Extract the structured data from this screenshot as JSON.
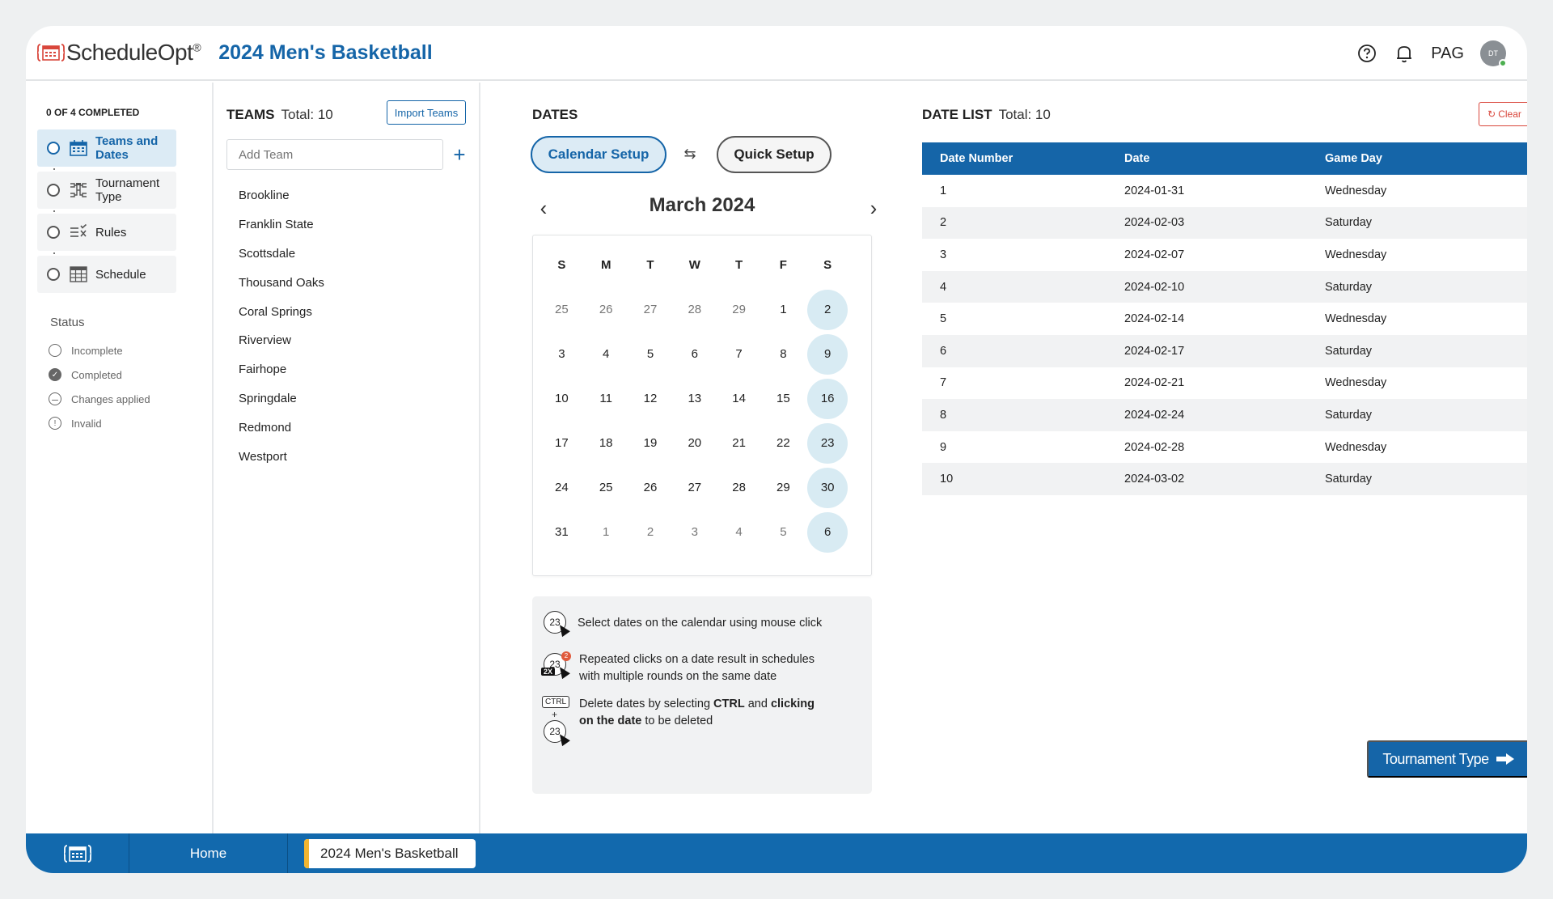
{
  "header": {
    "logo_text": "ScheduleOpt",
    "logo_reg": "®",
    "title": "2024 Men's Basketball",
    "user_initials_label": "PAG",
    "avatar_initials": "DT"
  },
  "progress": {
    "label": "0 OF 4 COMPLETED"
  },
  "steps": [
    {
      "label": "Teams and Dates",
      "icon": "calendar-icon",
      "active": true
    },
    {
      "label": "Tournament Type",
      "icon": "bracket-icon",
      "active": false
    },
    {
      "label": "Rules",
      "icon": "rules-icon",
      "active": false
    },
    {
      "label": "Schedule",
      "icon": "table-icon",
      "active": false
    }
  ],
  "status": {
    "title": "Status",
    "items": [
      {
        "label": "Incomplete",
        "icon": "empty-circle-icon"
      },
      {
        "label": "Completed",
        "icon": "check-circle-icon"
      },
      {
        "label": "Changes applied",
        "icon": "minus-circle-icon"
      },
      {
        "label": "Invalid",
        "icon": "exclamation-circle-icon"
      }
    ]
  },
  "teams": {
    "title": "TEAMS",
    "total": "Total: 10",
    "import_label": "Import Teams",
    "add_placeholder": "Add Team",
    "list": [
      "Brookline",
      "Franklin State",
      "Scottsdale",
      "Thousand Oaks",
      "Coral Springs",
      "Riverview",
      "Fairhope",
      "Springdale",
      "Redmond",
      "Westport"
    ]
  },
  "dates": {
    "title": "DATES",
    "calendar_setup": "Calendar Setup",
    "quick_setup": "Quick Setup",
    "month": "March 2024",
    "dow": [
      "S",
      "M",
      "T",
      "W",
      "T",
      "F",
      "S"
    ],
    "weeks": [
      [
        {
          "d": "25",
          "m": true
        },
        {
          "d": "26",
          "m": true
        },
        {
          "d": "27",
          "m": true
        },
        {
          "d": "28",
          "m": true
        },
        {
          "d": "29",
          "m": true
        },
        {
          "d": "1"
        },
        {
          "d": "2",
          "s": true
        }
      ],
      [
        {
          "d": "3"
        },
        {
          "d": "4"
        },
        {
          "d": "5"
        },
        {
          "d": "6"
        },
        {
          "d": "7"
        },
        {
          "d": "8"
        },
        {
          "d": "9",
          "s": true
        }
      ],
      [
        {
          "d": "10"
        },
        {
          "d": "11"
        },
        {
          "d": "12"
        },
        {
          "d": "13"
        },
        {
          "d": "14"
        },
        {
          "d": "15"
        },
        {
          "d": "16",
          "s": true
        }
      ],
      [
        {
          "d": "17"
        },
        {
          "d": "18"
        },
        {
          "d": "19"
        },
        {
          "d": "20"
        },
        {
          "d": "21"
        },
        {
          "d": "22"
        },
        {
          "d": "23",
          "s": true
        }
      ],
      [
        {
          "d": "24"
        },
        {
          "d": "25"
        },
        {
          "d": "26"
        },
        {
          "d": "27"
        },
        {
          "d": "28"
        },
        {
          "d": "29"
        },
        {
          "d": "30",
          "s": true
        }
      ],
      [
        {
          "d": "31"
        },
        {
          "d": "1",
          "m": true
        },
        {
          "d": "2",
          "m": true
        },
        {
          "d": "3",
          "m": true
        },
        {
          "d": "4",
          "m": true
        },
        {
          "d": "5",
          "m": true
        },
        {
          "d": "6",
          "s": true
        }
      ]
    ],
    "tips": {
      "tip1": "Select dates on the calendar using mouse click",
      "tip2_line1": "Repeated clicks on a date result in schedules",
      "tip2_line2": "with multiple rounds on the same date",
      "tip3_pre": "Delete dates by selecting ",
      "tip3_ctrl": "CTRL",
      "tip3_mid": " and ",
      "tip3_click": "clicking",
      "tip3_line2_bold": "on the date",
      "tip3_line2_rest": " to be deleted",
      "icon_num": "23",
      "badge_num": "2",
      "badge_2x": "2X",
      "key_ctrl": "CTRL",
      "plus": "+"
    }
  },
  "datelist": {
    "title": "DATE LIST",
    "total": "Total: 10",
    "clear_label": "Clear",
    "columns": [
      "Date Number",
      "Date",
      "Game Day"
    ],
    "rows": [
      [
        "1",
        "2024-01-31",
        "Wednesday"
      ],
      [
        "2",
        "2024-02-03",
        "Saturday"
      ],
      [
        "3",
        "2024-02-07",
        "Wednesday"
      ],
      [
        "4",
        "2024-02-10",
        "Saturday"
      ],
      [
        "5",
        "2024-02-14",
        "Wednesday"
      ],
      [
        "6",
        "2024-02-17",
        "Saturday"
      ],
      [
        "7",
        "2024-02-21",
        "Wednesday"
      ],
      [
        "8",
        "2024-02-24",
        "Saturday"
      ],
      [
        "9",
        "2024-02-28",
        "Wednesday"
      ],
      [
        "10",
        "2024-03-02",
        "Saturday"
      ]
    ],
    "next_label": "Tournament Type"
  },
  "footer": {
    "home_label": "Home",
    "tab_label": "2024 Men's Basketball"
  },
  "colors": {
    "brand_blue": "#1565a8",
    "footer_blue": "#1269ad",
    "selected_day": "#d8ebf3",
    "clear_red": "#d9463b",
    "tab_accent": "#f2b531"
  }
}
